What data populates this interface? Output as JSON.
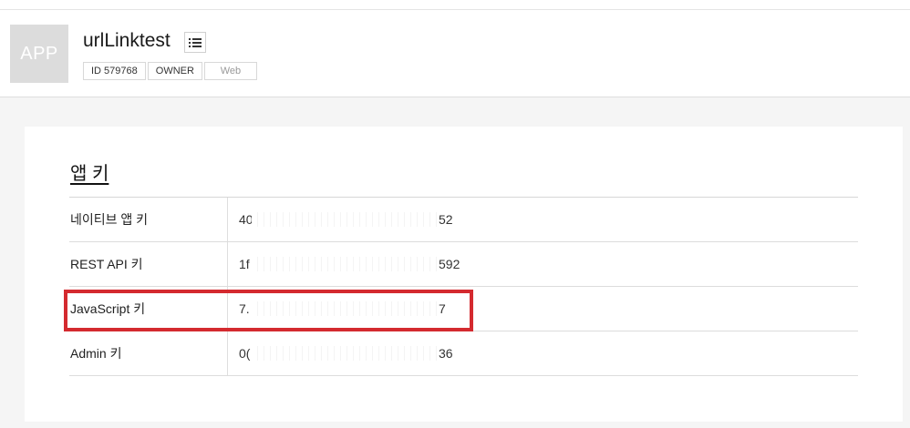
{
  "app": {
    "thumb_label": "APP",
    "title": "urlLinktest",
    "badges": [
      "ID 579768",
      "OWNER",
      "Web"
    ]
  },
  "section": {
    "title": "앱 키"
  },
  "keys": [
    {
      "label": "네이티브 앱 키",
      "value_start": "40",
      "value_end": "52"
    },
    {
      "label": "REST API 키",
      "value_start": "1f",
      "value_end": "592"
    },
    {
      "label": "JavaScript 키",
      "value_start": "7.",
      "value_end": "7"
    },
    {
      "label": "Admin 키",
      "value_start": "0(",
      "value_end": "36"
    }
  ],
  "icons": {
    "menu": "list-icon"
  },
  "colors": {
    "highlight": "#d42a2f"
  }
}
